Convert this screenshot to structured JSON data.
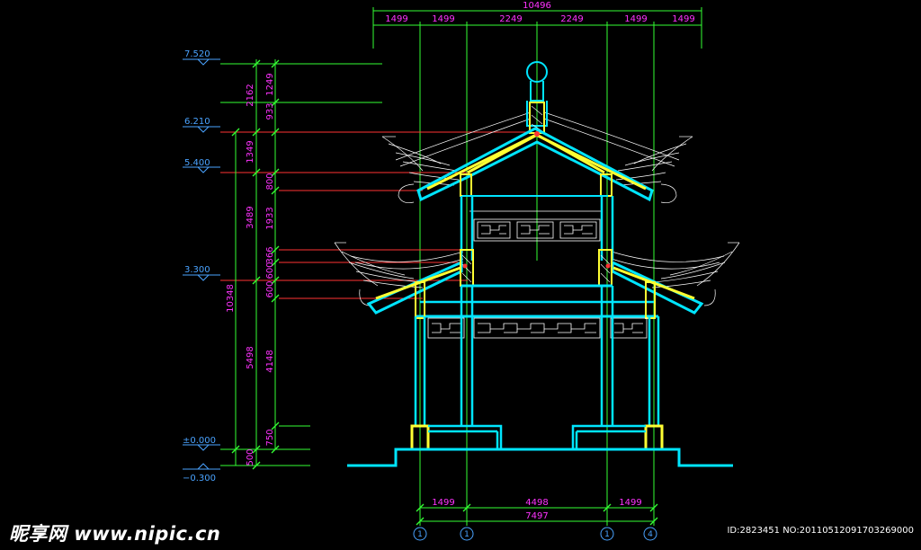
{
  "top_dims": {
    "total": "10496",
    "segments": [
      "1499",
      "1499",
      "2249",
      "2249",
      "1499",
      "1499"
    ]
  },
  "bottom_dims": {
    "segments": [
      "1499",
      "4498",
      "1499"
    ],
    "total": "7497"
  },
  "levels": [
    "7.520",
    "6.210",
    "5.400",
    "3.300",
    "±0.000",
    "−0.300"
  ],
  "left_dims": {
    "outer_total": "10348",
    "mid_col": [
      "2162",
      "1349",
      "3489",
      "5498",
      "500"
    ],
    "inner_col": [
      "1249",
      "933",
      "800",
      "1933",
      "366",
      "600",
      "600",
      "4148",
      "750"
    ]
  },
  "grid_labels": [
    "1",
    "1",
    "1",
    "4"
  ],
  "colors": {
    "wall": "#00e5ff",
    "section": "#ffff33",
    "dimension": "#ff33ff",
    "level": "#4aa3ff",
    "grid": "#33ff33",
    "roof_line": "#ffffff"
  },
  "watermark": "昵享网 www.nipic.cn",
  "image_id": "ID:2823451 NO:20110512091703269000"
}
